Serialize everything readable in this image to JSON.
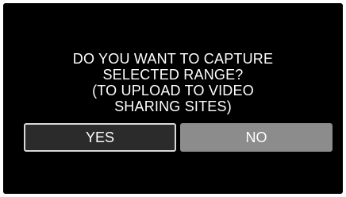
{
  "dialog": {
    "message_lines": [
      "DO YOU WANT TO CAPTURE",
      "SELECTED RANGE?",
      "(TO UPLOAD TO VIDEO",
      "SHARING SITES)"
    ],
    "yes_label": "YES",
    "no_label": "NO",
    "selected_button": "YES"
  },
  "colors": {
    "screen_background": "#000000",
    "text": "#ffffff",
    "selected_button_fill": "#2b2b2b",
    "selected_button_border": "#d8d8d8",
    "unselected_button_fill": "#8c8c8c"
  }
}
